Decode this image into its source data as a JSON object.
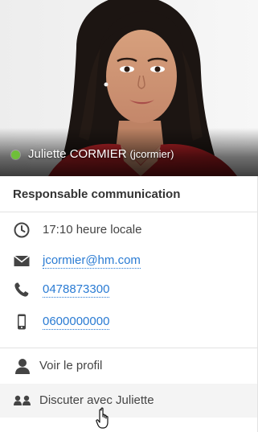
{
  "profile": {
    "name": "Juliette CORMIER",
    "login": "(jcormier)",
    "presence_color": "#6fbf3a",
    "job_title": "Responsable communication"
  },
  "contact": {
    "local_time": "17:10 heure locale",
    "email": "jcormier@hm.com",
    "phone": "0478873300",
    "mobile": "0600000000"
  },
  "actions": {
    "view_profile": "Voir le profil",
    "chat": "Discuter avec Juliette"
  },
  "icons": {
    "time": "clock-icon",
    "email": "envelope-icon",
    "phone": "phone-icon",
    "mobile": "mobile-phone-icon",
    "profile": "user-icon",
    "chat": "users-icon",
    "cursor": "hand-pointer-cursor"
  },
  "colors": {
    "link": "#2a7bd3",
    "text": "#444444",
    "hover_bg": "#f4f4f4"
  }
}
